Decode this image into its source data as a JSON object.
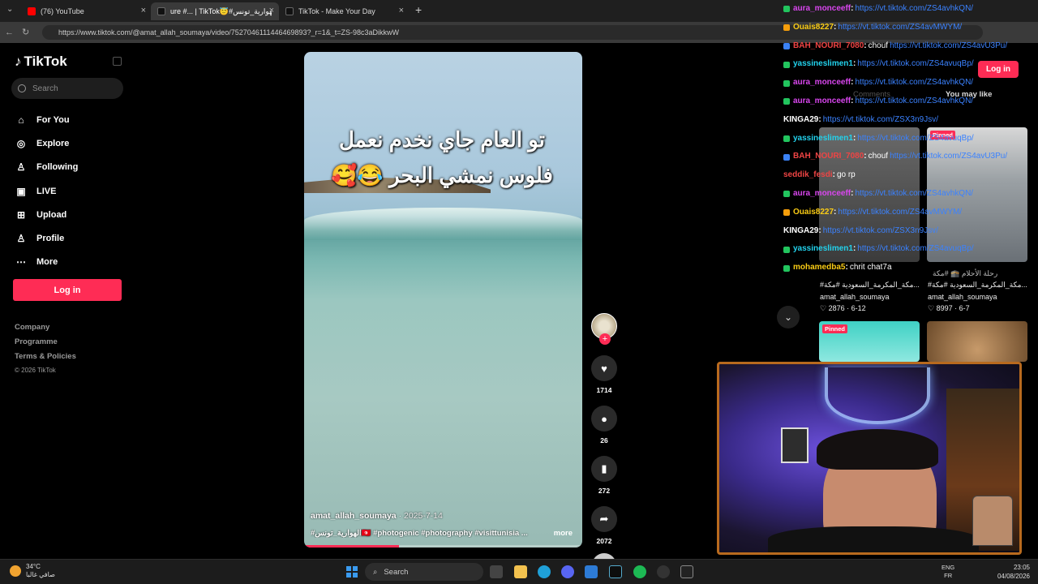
{
  "browser": {
    "tabs": [
      {
        "title": "(76) YouTube",
        "color": "#ff0000"
      },
      {
        "title": "ure #... | TikTok😇#الهوارية_تونس",
        "color": "#111111"
      },
      {
        "title": "TikTok - Make Your Day",
        "color": "#111111"
      }
    ],
    "url": "https://www.tiktok.com/@amat_allah_soumaya/video/7527046111446469893?_r=1&_t=ZS-98c3aDikkwW"
  },
  "sidebar": {
    "logo": "TikTok",
    "search_placeholder": "Search",
    "items": [
      {
        "label": "For You",
        "icon": "⌂"
      },
      {
        "label": "Explore",
        "icon": "◎"
      },
      {
        "label": "Following",
        "icon": "♙"
      },
      {
        "label": "LIVE",
        "icon": "▣"
      },
      {
        "label": "Upload",
        "icon": "⊞"
      },
      {
        "label": "Profile",
        "icon": "♙"
      },
      {
        "label": "More",
        "icon": "⋯"
      }
    ],
    "login": "Log in",
    "footer": [
      "Company",
      "Programme",
      "Terms & Policies"
    ],
    "copyright": "© 2026 TikTok"
  },
  "video": {
    "caption_line1": "تو العام جاي نخدم نعمل",
    "caption_line2": "فلوس نمشي البحر 😂🥰",
    "username": "amat_allah_soumaya",
    "date": "· 2025-7-14",
    "tags": "#الهوارية_تونس🇹🇳 #photogenic #photography #visittunisia ...",
    "more": "more",
    "progress_fraction": 0.34
  },
  "actions": {
    "likes": "1714",
    "comments": "26",
    "saves": "272",
    "shares": "2072",
    "follow": "+"
  },
  "chat": [
    {
      "user": "aura_monceeff",
      "color": "#d946ef",
      "badge": "#22c55e",
      "link": "https://vt.tiktok.com/ZS4avhkQN/"
    },
    {
      "user": "Ouais8227",
      "color": "#facc15",
      "badge": "#f59e0b",
      "link": "https://vt.tiktok.com/ZS4avMWYM/"
    },
    {
      "user": "BAH_NOURI_7080",
      "color": "#ef4444",
      "badge": "#3b82f6",
      "msg": "chouf",
      "link": "https://vt.tiktok.com/ZS4avU3Pu/"
    },
    {
      "user": "yassineslimen1",
      "color": "#22d3ee",
      "badge": "#22c55e",
      "link": "https://vt.tiktok.com/ZS4avuqBp/"
    },
    {
      "user": "aura_monceeff",
      "color": "#d946ef",
      "badge": "#22c55e",
      "link": "https://vt.tiktok.com/ZS4avhkQN/"
    },
    {
      "user": "aura_monceeff",
      "color": "#d946ef",
      "badge": "#22c55e",
      "link": "https://vt.tiktok.com/ZS4avhkQN/"
    },
    {
      "user": "KINGA29",
      "color": "#ffffff",
      "badge": "",
      "link": "https://vt.tiktok.com/ZSX3n9Jsv/"
    },
    {
      "user": "yassineslimen1",
      "color": "#22d3ee",
      "badge": "#22c55e",
      "link": "https://vt.tiktok.com/ZS4avuqBp/"
    },
    {
      "user": "BAH_NOURI_7080",
      "color": "#ef4444",
      "badge": "#3b82f6",
      "msg": "chouf",
      "link": "https://vt.tiktok.com/ZS4avU3Pu/"
    },
    {
      "user": "seddik_fesdi",
      "color": "#ef4444",
      "badge": "",
      "msg": "go rp",
      "link": ""
    },
    {
      "user": "aura_monceeff",
      "color": "#d946ef",
      "badge": "#22c55e",
      "link": "https://vt.tiktok.com/ZS4avhkQN/"
    },
    {
      "user": "Ouais8227",
      "color": "#facc15",
      "badge": "#f59e0b",
      "link": "https://vt.tiktok.com/ZS4avMWYM/"
    },
    {
      "user": "KINGA29",
      "color": "#ffffff",
      "badge": "",
      "link": "https://vt.tiktok.com/ZSX3n9Jsv/"
    },
    {
      "user": "yassineslimen1",
      "color": "#22d3ee",
      "badge": "#22c55e",
      "link": "https://vt.tiktok.com/ZS4avuqBp/"
    },
    {
      "user": "mohamedba5",
      "color": "#facc15",
      "badge": "#22c55e",
      "msg": "chrit chat7a",
      "link": ""
    }
  ],
  "right_panel": {
    "login": "Log in",
    "comments_tab": "Comments",
    "you_may_like": "You may like",
    "pinned": "Pinned",
    "cards": [
      {
        "title": "#مكة_المكرمة_السعودية #مكة...",
        "author": "amat_allah_soumaya",
        "stats": "♡ 2876 · 6-12"
      },
      {
        "title": "#مكة_المكرمة_السعودية #مكة...",
        "author": "amat_allah_soumaya",
        "stats": "♡ 8997 · 6-7"
      }
    ],
    "card2_overlay": "رحلة الأحلام 🕋 #مكة"
  },
  "taskbar": {
    "temp": "34°C",
    "weather": "صافي غالبا",
    "search": "Search",
    "lang_top": "ENG",
    "lang_bottom": "FR",
    "time": "23:05",
    "date": "04/08/2026"
  }
}
